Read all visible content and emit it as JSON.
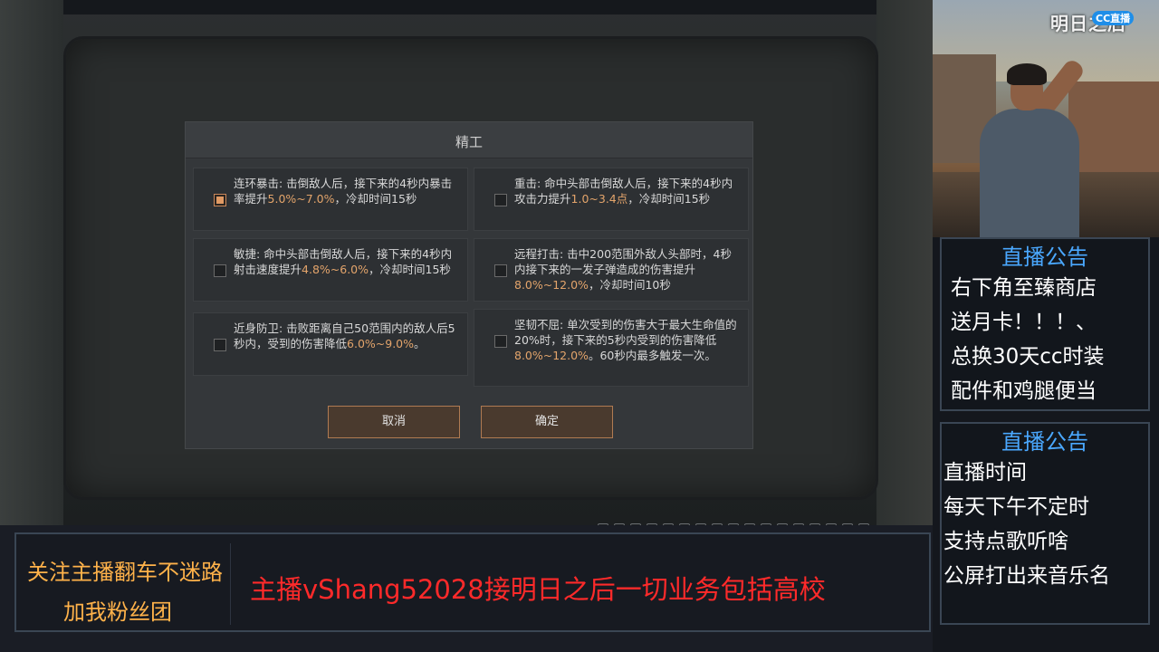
{
  "dialog": {
    "title": "精工",
    "options": [
      {
        "name": "连环暴击",
        "pre": "连环暴击: 击倒敌人后，接下来的4秒内暴击率提升",
        "hl": "5.0%~7.0%",
        "post": "，冷却时间15秒",
        "checked": true
      },
      {
        "name": "重击",
        "pre": "重击: 命中头部击倒敌人后，接下来的4秒内攻击力提升",
        "hl": "1.0~3.4点",
        "post": "，冷却时间15秒",
        "checked": false
      },
      {
        "name": "敏捷",
        "pre": "敏捷: 命中头部击倒敌人后，接下来的4秒内射击速度提升",
        "hl": "4.8%~6.0%",
        "post": "，冷却时间15秒",
        "checked": false
      },
      {
        "name": "远程打击",
        "pre": "远程打击: 击中200范围外敌人头部时，4秒内接下来的一发子弹造成的伤害提升",
        "hl": "8.0%~12.0%",
        "post": "，冷却时间10秒",
        "checked": false
      },
      {
        "name": "近身防卫",
        "pre": "近身防卫: 击败距离自己50范围内的敌人后5秒内，受到的伤害降低",
        "hl": "6.0%~9.0%",
        "post": "。",
        "checked": false
      },
      {
        "name": "坚韧不屈",
        "pre": "坚韧不屈: 单次受到的伤害大于最大生命值的20%时，接下来的5秒内受到的伤害降低",
        "hl": "8.0%~12.0%",
        "post": "。60秒内最多触发一次。",
        "checked": false
      }
    ],
    "cancel_label": "取消",
    "confirm_label": "确定"
  },
  "right_panel": {
    "brand": "明日之后",
    "brand_badge": "CC直播",
    "notice1": {
      "title": "直播公告",
      "lines": [
        "右下角至臻商店",
        "送月卡！！！、",
        "总换30天cc时装",
        "配件和鸡腿便当"
      ]
    },
    "notice2": {
      "title": "直播公告",
      "lines": [
        "直播时间",
        "每天下午不定时",
        "支持点歌听啥",
        "公屏打出来音乐名"
      ]
    }
  },
  "bottom": {
    "follow_line1": "关注主播翻车不迷路",
    "follow_line2": "加我粉丝团",
    "promo": "主播vShang52028接明日之后一切业务包括高校"
  },
  "colors": {
    "highlight": "#e3a46b",
    "notice_title": "#4aa8ff",
    "follow_text": "#ffb24a",
    "promo_text": "#ff2a2a"
  }
}
